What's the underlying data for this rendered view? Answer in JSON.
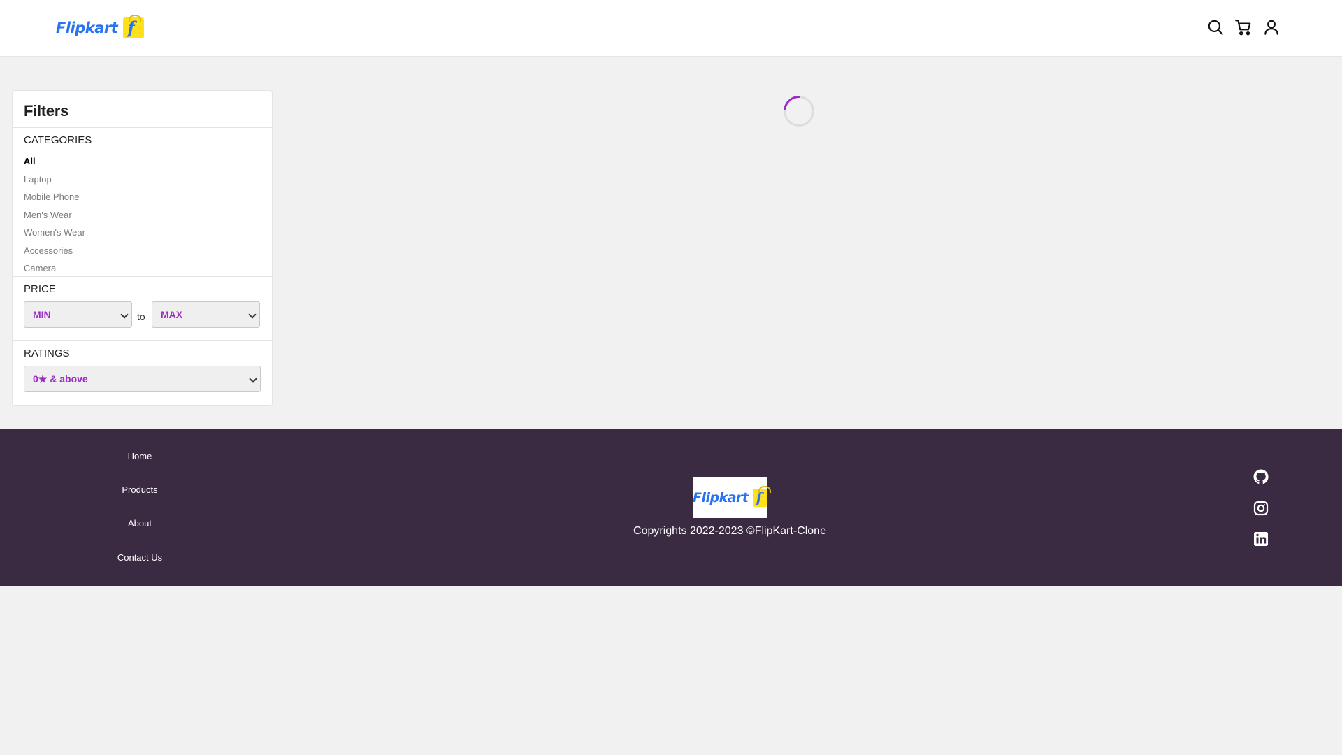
{
  "header": {
    "logo_text": "Flipkart",
    "icons": [
      "search-icon",
      "cart-icon",
      "user-icon"
    ]
  },
  "filters": {
    "title": "Filters",
    "categories": {
      "title": "CATEGORIES",
      "items": [
        {
          "label": "All",
          "active": true
        },
        {
          "label": "Laptop"
        },
        {
          "label": "Mobile Phone"
        },
        {
          "label": "Men's Wear"
        },
        {
          "label": "Women's Wear"
        },
        {
          "label": "Accessories"
        },
        {
          "label": "Camera"
        }
      ]
    },
    "price": {
      "title": "PRICE",
      "min_label": "MIN",
      "to_label": "to",
      "max_label": "MAX"
    },
    "ratings": {
      "title": "RATINGS",
      "selected": "0★ & above"
    }
  },
  "footer": {
    "links": [
      "Home",
      "Products",
      "About",
      "Contact Us"
    ],
    "logo_text": "Flipkart",
    "copyright": "Copyrights 2022-2023 ©FlipKart-Clone",
    "social": [
      "github-icon",
      "instagram-icon",
      "linkedin-icon"
    ]
  },
  "colors": {
    "brand_blue": "#2874f0",
    "brand_yellow": "#ffe11b",
    "accent_purple": "#9b2cc4",
    "footer_bg": "#3a2a42",
    "page_bg": "#f1f1f1"
  }
}
